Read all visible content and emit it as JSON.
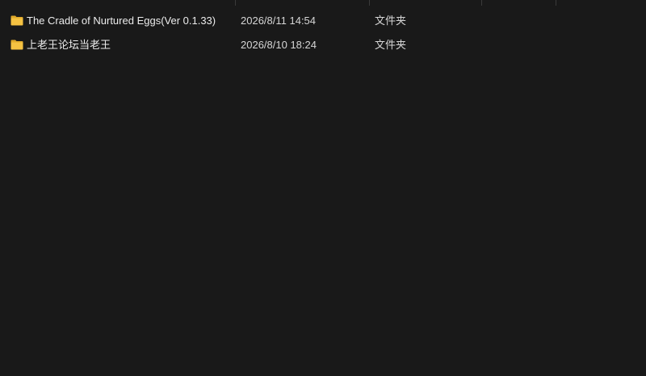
{
  "colors": {
    "background": "#191919",
    "folder_icon": "#f5c242",
    "folder_icon_tab": "#e0a92a"
  },
  "files": [
    {
      "icon": "folder-icon",
      "name": "The Cradle of Nurtured Eggs(Ver 0.1.33)",
      "date_modified": "2026/8/11 14:54",
      "type": "文件夹"
    },
    {
      "icon": "folder-icon",
      "name": "上老王论坛当老王",
      "date_modified": "2026/8/10 18:24",
      "type": "文件夹"
    }
  ]
}
